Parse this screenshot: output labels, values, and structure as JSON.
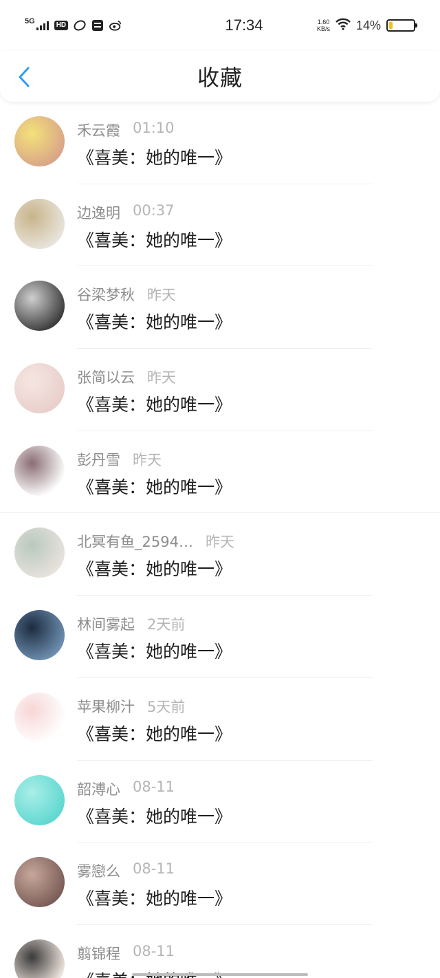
{
  "status_bar": {
    "network": "5G",
    "hd": "HD",
    "time": "17:34",
    "speed_value": "1.60",
    "speed_unit": "KB/s",
    "battery_pct": "14%",
    "battery_level": 0.14,
    "icons": [
      "signal-icon",
      "hd-icon",
      "app-icon-1",
      "taobao-icon",
      "weibo-icon",
      "wifi-icon",
      "battery-icon"
    ]
  },
  "header": {
    "title": "收藏",
    "back_icon": "chevron-left-icon",
    "accent_color": "#2d9cf0"
  },
  "favorites": [
    {
      "name": "禾云霞",
      "time": "01:10",
      "title": "《喜美：她的唯一》",
      "avatar_colors": [
        "#d9a488",
        "#f3e27a"
      ]
    },
    {
      "name": "边逸明",
      "time": "00:37",
      "title": "《喜美：她的唯一》",
      "avatar_colors": [
        "#e8e4dc",
        "#c9b48a"
      ]
    },
    {
      "name": "谷梁梦秋",
      "time": "昨天",
      "title": "《喜美：她的唯一》",
      "avatar_colors": [
        "#3b3b3b",
        "#cfcfcf"
      ]
    },
    {
      "name": "张简以云",
      "time": "昨天",
      "title": "《喜美：她的唯一》",
      "avatar_colors": [
        "#e9cfcb",
        "#f5e6e2"
      ]
    },
    {
      "name": "彭丹雪",
      "time": "昨天",
      "title": "《喜美：她的唯一》",
      "avatar_colors": [
        "#ffffff",
        "#8a6e74"
      ]
    },
    {
      "name": "北冥有鱼_2594…",
      "time": "昨天",
      "title": "《喜美：她的唯一》",
      "avatar_colors": [
        "#e7e2dc",
        "#b9c9bf"
      ]
    },
    {
      "name": "林间雾起",
      "time": "2天前",
      "title": "《喜美：她的唯一》",
      "avatar_colors": [
        "#6d8fb0",
        "#1d2c40"
      ]
    },
    {
      "name": "苹果柳汁",
      "time": "5天前",
      "title": "《喜美：她的唯一》",
      "avatar_colors": [
        "#ffffff",
        "#f7d6d6"
      ]
    },
    {
      "name": "韶溥心",
      "time": "08-11",
      "title": "《喜美：她的唯一》",
      "avatar_colors": [
        "#5fd8d0",
        "#a9eee8"
      ]
    },
    {
      "name": "雾戀么",
      "time": "08-11",
      "title": "《喜美：她的唯一》",
      "avatar_colors": [
        "#7a5d57",
        "#c7a79a"
      ]
    },
    {
      "name": "翦锦程",
      "time": "08-11",
      "title": "《喜美：她的唯一》",
      "avatar_colors": [
        "#f1e6de",
        "#3a3a3a"
      ]
    }
  ]
}
